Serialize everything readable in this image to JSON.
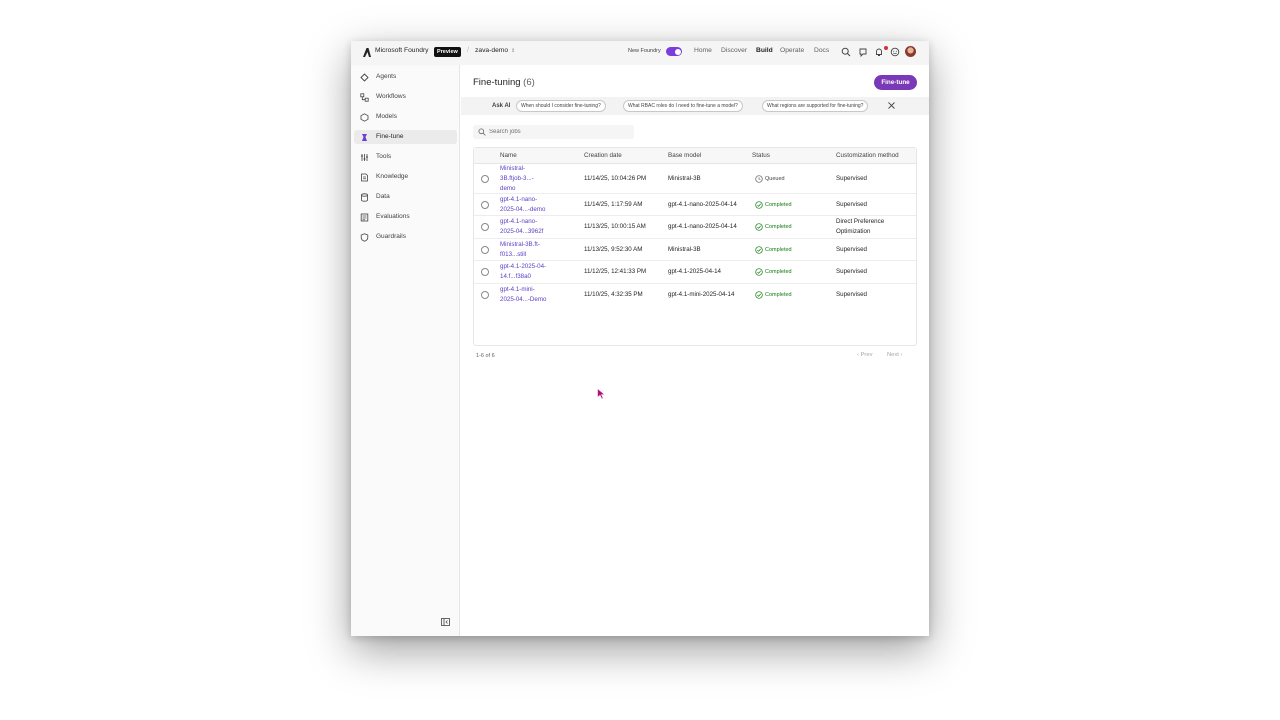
{
  "topbar": {
    "brand": "Microsoft Foundry",
    "badge": "Preview",
    "project": "zava-demo",
    "new_foundry_label": "New Foundry",
    "nav": [
      "Home",
      "Discover",
      "Build",
      "Operate",
      "Docs"
    ],
    "active_nav": "Build"
  },
  "sidebar": {
    "items": [
      {
        "label": "Agents",
        "icon": "agents-icon"
      },
      {
        "label": "Workflows",
        "icon": "workflows-icon"
      },
      {
        "label": "Models",
        "icon": "models-icon"
      },
      {
        "label": "Fine-tune",
        "icon": "fine-tune-icon",
        "active": true
      },
      {
        "label": "Tools",
        "icon": "tools-icon"
      },
      {
        "label": "Knowledge",
        "icon": "knowledge-icon"
      },
      {
        "label": "Data",
        "icon": "data-icon"
      },
      {
        "label": "Evaluations",
        "icon": "evaluations-icon"
      },
      {
        "label": "Guardrails",
        "icon": "guardrails-icon"
      }
    ]
  },
  "main": {
    "title": "Fine-tuning",
    "count": "(6)",
    "primary_button": "Fine-tune",
    "ask_ai": {
      "label": "Ask AI",
      "chips": [
        "When should I consider fine-tuning?",
        "What RBAC roles do I need to fine-tune a model?",
        "What regions are supported for fine-tuning?"
      ]
    },
    "search_placeholder": "Search jobs",
    "table": {
      "columns": [
        "Name",
        "Creation date",
        "Base model",
        "Status",
        "Customization method"
      ],
      "rows": [
        {
          "name": "Ministral-3B.ftjob-3...-demo",
          "name_lines": [
            "Ministral-",
            "3B.ftjob-3...-",
            "demo"
          ],
          "date": "11/14/25, 10:04:26 PM",
          "base_model": "Ministral-3B",
          "status": "Queued",
          "method": "Supervised"
        },
        {
          "name": "gpt-4.1-nano-2025-04...-demo",
          "name_lines": [
            "gpt-4.1-nano-",
            "2025-04...-demo"
          ],
          "date": "11/14/25, 1:17:59 AM",
          "base_model": "gpt-4.1-nano-2025-04-14",
          "status": "Completed",
          "method": "Supervised"
        },
        {
          "name": "gpt-4.1-nano-2025-04...3962f",
          "name_lines": [
            "gpt-4.1-nano-",
            "2025-04...3962f"
          ],
          "date": "11/13/25, 10:00:15 AM",
          "base_model": "gpt-4.1-nano-2025-04-14",
          "status": "Completed",
          "method": "Direct Preference Optimization"
        },
        {
          "name": "Ministral-3B.ft-f013...still",
          "name_lines": [
            "Ministral-3B.ft-",
            "f013...still"
          ],
          "date": "11/13/25, 9:52:30 AM",
          "base_model": "Ministral-3B",
          "status": "Completed",
          "method": "Supervised"
        },
        {
          "name": "gpt-4.1-2025-04-14.f...f38a0",
          "name_lines": [
            "gpt-4.1-2025-04-",
            "14.f...f38a0"
          ],
          "date": "11/12/25, 12:41:33 PM",
          "base_model": "gpt-4.1-2025-04-14",
          "status": "Completed",
          "method": "Supervised"
        },
        {
          "name": "gpt-4.1-mini-2025-04...-Demo",
          "name_lines": [
            "gpt-4.1-mini-",
            "2025-04...-Demo"
          ],
          "date": "11/10/25, 4:32:35 PM",
          "base_model": "gpt-4.1-mini-2025-04-14",
          "status": "Completed",
          "method": "Supervised"
        }
      ]
    },
    "pagination": {
      "info": "1-6 of 6",
      "prev": "Prev",
      "next": "Next"
    }
  },
  "colors": {
    "accent": "#7a3ab8",
    "link": "#5b3fc4",
    "success": "#107c10",
    "toggle": "#7a3ddb"
  }
}
